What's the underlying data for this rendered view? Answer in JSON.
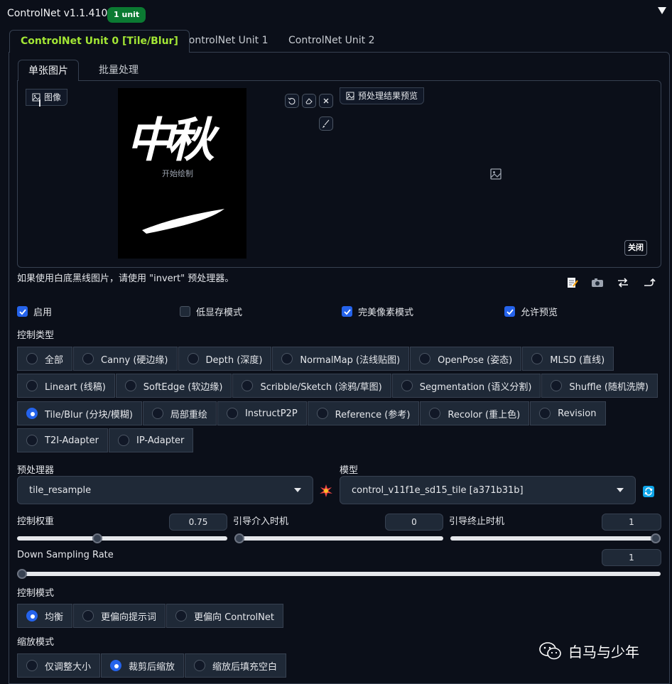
{
  "header": {
    "title": "ControlNet v1.1.410",
    "badge": "1 unit"
  },
  "unit_tabs": [
    "ControlNet Unit 0 [Tile/Blur]",
    "ControlNet Unit 1",
    "ControlNet Unit 2"
  ],
  "image_tabs": [
    "单张图片",
    "批量处理"
  ],
  "image_label": "图像",
  "canvas_overlay_text": "开始绘制",
  "canvas_calligraphy": "中秋",
  "preview_label": "预处理结果预览",
  "close_label": "关闭",
  "hint": "如果使用白底黑线图片，请使用 \"invert\" 预处理器。",
  "checkboxes": [
    {
      "label": "启用",
      "checked": true
    },
    {
      "label": "低显存模式",
      "checked": false
    },
    {
      "label": "完美像素模式",
      "checked": true
    },
    {
      "label": "允许预览",
      "checked": true
    }
  ],
  "control_type_label": "控制类型",
  "control_types": [
    [
      "全部",
      "Canny (硬边缘)",
      "Depth (深度)",
      "NormalMap (法线贴图)",
      "OpenPose (姿态)",
      "MLSD (直线)"
    ],
    [
      "Lineart (线稿)",
      "SoftEdge (软边缘)",
      "Scribble/Sketch (涂鸦/草图)",
      "Segmentation (语义分割)",
      "Shuffle (随机洗牌)"
    ],
    [
      "Tile/Blur (分块/模糊)",
      "局部重绘",
      "InstructP2P",
      "Reference (参考)",
      "Recolor (重上色)",
      "Revision"
    ],
    [
      "T2I-Adapter",
      "IP-Adapter"
    ]
  ],
  "control_type_selected": "Tile/Blur (分块/模糊)",
  "preprocessor": {
    "label": "预处理器",
    "value": "tile_resample"
  },
  "model": {
    "label": "模型",
    "value": "control_v11f1e_sd15_tile [a371b31b]"
  },
  "sliders": {
    "weight": {
      "label": "控制权重",
      "value": "0.75",
      "fraction": 0.375
    },
    "start": {
      "label": "引导介入时机",
      "value": "0",
      "fraction": 0
    },
    "end": {
      "label": "引导终止时机",
      "value": "1",
      "fraction": 1
    },
    "down_sampling": {
      "label": "Down Sampling Rate",
      "value": "1",
      "fraction": 0
    }
  },
  "control_mode": {
    "label": "控制模式",
    "options": [
      "均衡",
      "更偏向提示词",
      "更偏向 ControlNet"
    ],
    "selected": "均衡"
  },
  "resize_mode": {
    "label": "缩放模式",
    "options": [
      "仅调整大小",
      "裁剪后缩放",
      "缩放后填充空白"
    ],
    "selected": "裁剪后缩放"
  },
  "watermark": "白马与少年",
  "colors": {
    "accent": "#2563eb",
    "tab_active": "#a3e635",
    "badge": "#0b7a32",
    "bg": "#0b0f19"
  }
}
